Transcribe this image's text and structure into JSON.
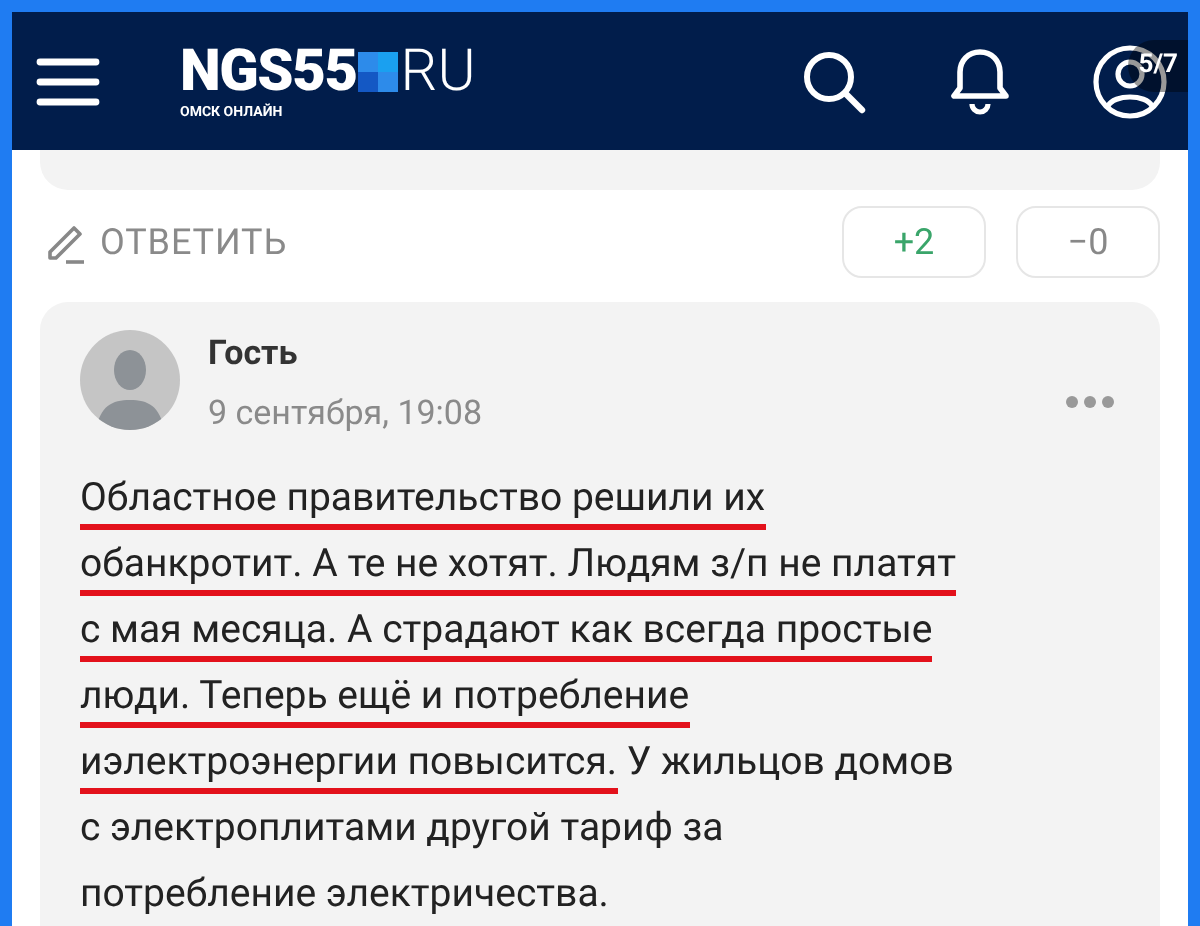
{
  "header": {
    "logo": {
      "name": "NGS55",
      "domain": "RU",
      "tagline": "ОМСК ОНЛАЙН"
    }
  },
  "slide_counter": "5/7",
  "reply_bar": {
    "reply": "ОТВЕТИТЬ",
    "votes": [
      {
        "label": "+2",
        "kind": "up"
      },
      {
        "label": "−0",
        "kind": "down"
      }
    ]
  },
  "comment": {
    "author": "Гость",
    "date": "9 сентября, 19:08",
    "lines": [
      [
        {
          "text": "Областное правительство решили их",
          "underlined": true
        }
      ],
      [
        {
          "text": "обанкротит. А те не хотят. Людям з/п не платят",
          "underlined": true
        }
      ],
      [
        {
          "text": "с мая месяца. А страдают как всегда простые",
          "underlined": true
        }
      ],
      [
        {
          "text": "люди. Теперь ещё и потребление",
          "underlined": true
        }
      ],
      [
        {
          "text": "иэлектроэнергии повысится.",
          "underlined": true
        },
        {
          "text": " У жильцов домов",
          "underlined": false
        }
      ],
      [
        {
          "text": "с электроплитами другой тариф за",
          "underlined": false
        }
      ],
      [
        {
          "text": "потребление электричества.",
          "underlined": false
        }
      ]
    ]
  }
}
